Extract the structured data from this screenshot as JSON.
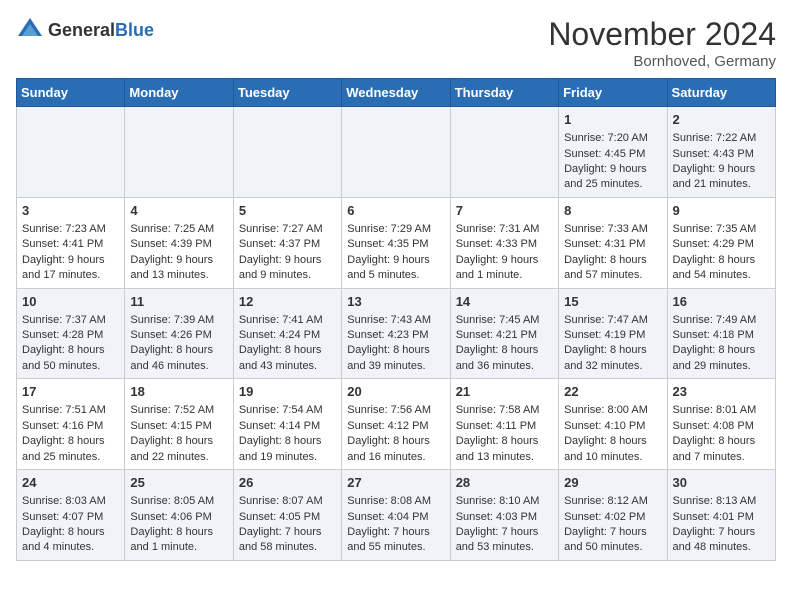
{
  "header": {
    "logo_general": "General",
    "logo_blue": "Blue",
    "month_title": "November 2024",
    "location": "Bornhoved, Germany"
  },
  "days_of_week": [
    "Sunday",
    "Monday",
    "Tuesday",
    "Wednesday",
    "Thursday",
    "Friday",
    "Saturday"
  ],
  "weeks": [
    [
      {
        "day": "",
        "content": ""
      },
      {
        "day": "",
        "content": ""
      },
      {
        "day": "",
        "content": ""
      },
      {
        "day": "",
        "content": ""
      },
      {
        "day": "",
        "content": ""
      },
      {
        "day": "1",
        "content": "Sunrise: 7:20 AM\nSunset: 4:45 PM\nDaylight: 9 hours and 25 minutes."
      },
      {
        "day": "2",
        "content": "Sunrise: 7:22 AM\nSunset: 4:43 PM\nDaylight: 9 hours and 21 minutes."
      }
    ],
    [
      {
        "day": "3",
        "content": "Sunrise: 7:23 AM\nSunset: 4:41 PM\nDaylight: 9 hours and 17 minutes."
      },
      {
        "day": "4",
        "content": "Sunrise: 7:25 AM\nSunset: 4:39 PM\nDaylight: 9 hours and 13 minutes."
      },
      {
        "day": "5",
        "content": "Sunrise: 7:27 AM\nSunset: 4:37 PM\nDaylight: 9 hours and 9 minutes."
      },
      {
        "day": "6",
        "content": "Sunrise: 7:29 AM\nSunset: 4:35 PM\nDaylight: 9 hours and 5 minutes."
      },
      {
        "day": "7",
        "content": "Sunrise: 7:31 AM\nSunset: 4:33 PM\nDaylight: 9 hours and 1 minute."
      },
      {
        "day": "8",
        "content": "Sunrise: 7:33 AM\nSunset: 4:31 PM\nDaylight: 8 hours and 57 minutes."
      },
      {
        "day": "9",
        "content": "Sunrise: 7:35 AM\nSunset: 4:29 PM\nDaylight: 8 hours and 54 minutes."
      }
    ],
    [
      {
        "day": "10",
        "content": "Sunrise: 7:37 AM\nSunset: 4:28 PM\nDaylight: 8 hours and 50 minutes."
      },
      {
        "day": "11",
        "content": "Sunrise: 7:39 AM\nSunset: 4:26 PM\nDaylight: 8 hours and 46 minutes."
      },
      {
        "day": "12",
        "content": "Sunrise: 7:41 AM\nSunset: 4:24 PM\nDaylight: 8 hours and 43 minutes."
      },
      {
        "day": "13",
        "content": "Sunrise: 7:43 AM\nSunset: 4:23 PM\nDaylight: 8 hours and 39 minutes."
      },
      {
        "day": "14",
        "content": "Sunrise: 7:45 AM\nSunset: 4:21 PM\nDaylight: 8 hours and 36 minutes."
      },
      {
        "day": "15",
        "content": "Sunrise: 7:47 AM\nSunset: 4:19 PM\nDaylight: 8 hours and 32 minutes."
      },
      {
        "day": "16",
        "content": "Sunrise: 7:49 AM\nSunset: 4:18 PM\nDaylight: 8 hours and 29 minutes."
      }
    ],
    [
      {
        "day": "17",
        "content": "Sunrise: 7:51 AM\nSunset: 4:16 PM\nDaylight: 8 hours and 25 minutes."
      },
      {
        "day": "18",
        "content": "Sunrise: 7:52 AM\nSunset: 4:15 PM\nDaylight: 8 hours and 22 minutes."
      },
      {
        "day": "19",
        "content": "Sunrise: 7:54 AM\nSunset: 4:14 PM\nDaylight: 8 hours and 19 minutes."
      },
      {
        "day": "20",
        "content": "Sunrise: 7:56 AM\nSunset: 4:12 PM\nDaylight: 8 hours and 16 minutes."
      },
      {
        "day": "21",
        "content": "Sunrise: 7:58 AM\nSunset: 4:11 PM\nDaylight: 8 hours and 13 minutes."
      },
      {
        "day": "22",
        "content": "Sunrise: 8:00 AM\nSunset: 4:10 PM\nDaylight: 8 hours and 10 minutes."
      },
      {
        "day": "23",
        "content": "Sunrise: 8:01 AM\nSunset: 4:08 PM\nDaylight: 8 hours and 7 minutes."
      }
    ],
    [
      {
        "day": "24",
        "content": "Sunrise: 8:03 AM\nSunset: 4:07 PM\nDaylight: 8 hours and 4 minutes."
      },
      {
        "day": "25",
        "content": "Sunrise: 8:05 AM\nSunset: 4:06 PM\nDaylight: 8 hours and 1 minute."
      },
      {
        "day": "26",
        "content": "Sunrise: 8:07 AM\nSunset: 4:05 PM\nDaylight: 7 hours and 58 minutes."
      },
      {
        "day": "27",
        "content": "Sunrise: 8:08 AM\nSunset: 4:04 PM\nDaylight: 7 hours and 55 minutes."
      },
      {
        "day": "28",
        "content": "Sunrise: 8:10 AM\nSunset: 4:03 PM\nDaylight: 7 hours and 53 minutes."
      },
      {
        "day": "29",
        "content": "Sunrise: 8:12 AM\nSunset: 4:02 PM\nDaylight: 7 hours and 50 minutes."
      },
      {
        "day": "30",
        "content": "Sunrise: 8:13 AM\nSunset: 4:01 PM\nDaylight: 7 hours and 48 minutes."
      }
    ]
  ]
}
